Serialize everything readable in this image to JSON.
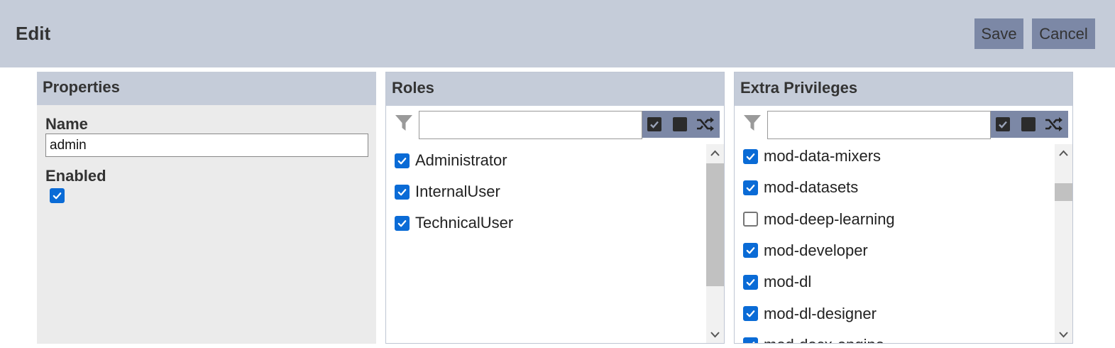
{
  "header": {
    "title": "Edit",
    "save_label": "Save",
    "cancel_label": "Cancel"
  },
  "properties": {
    "title": "Properties",
    "name_label": "Name",
    "name_value": "admin",
    "enabled_label": "Enabled",
    "enabled": true
  },
  "roles": {
    "title": "Roles",
    "filter_value": "",
    "items": [
      {
        "label": "Administrator",
        "checked": true
      },
      {
        "label": "InternalUser",
        "checked": true
      },
      {
        "label": "TechnicalUser",
        "checked": true
      }
    ]
  },
  "privileges": {
    "title": "Extra Privileges",
    "filter_value": "",
    "items": [
      {
        "label": "mod-data-mixers",
        "checked": true
      },
      {
        "label": "mod-datasets",
        "checked": true
      },
      {
        "label": "mod-deep-learning",
        "checked": false
      },
      {
        "label": "mod-developer",
        "checked": true
      },
      {
        "label": "mod-dl",
        "checked": true
      },
      {
        "label": "mod-dl-designer",
        "checked": true
      },
      {
        "label": "mod-docx-engine",
        "checked": true
      }
    ]
  },
  "icons": {
    "filter": "filter-icon",
    "check_all": "check-all-icon",
    "uncheck_all": "uncheck-all-icon",
    "invert": "shuffle-icon"
  },
  "colors": {
    "header_bg": "#c5ccd9",
    "button_bg": "#7c88a6",
    "checkbox_blue": "#0a6bd6",
    "panel_bg": "#ebebeb"
  }
}
